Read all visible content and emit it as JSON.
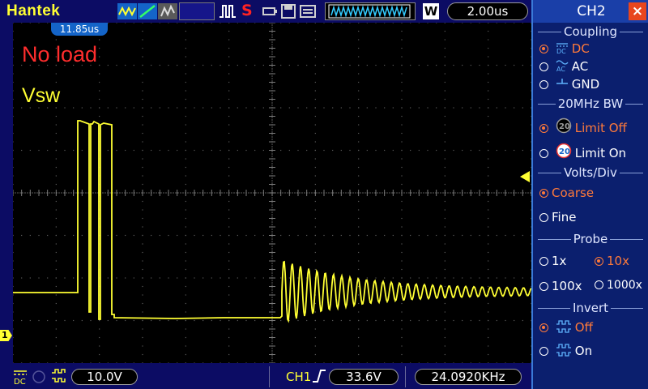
{
  "topbar": {
    "brand": "Hantek",
    "run_stop": "S",
    "format_label": "W",
    "timebase": "2.00us"
  },
  "screen": {
    "trigger_position": "11.85us",
    "annotation_noload": "No load",
    "annotation_vsw": "Vsw",
    "channel_marker": "1"
  },
  "bottombar": {
    "ch_volts": "10.0V",
    "trigger_source": "CH1",
    "trigger_level": "33.6V",
    "frequency": "24.0920KHz"
  },
  "menu": {
    "title": "CH2",
    "coupling": {
      "title": "Coupling",
      "options": [
        "DC",
        "AC",
        "GND"
      ],
      "selected": "DC"
    },
    "bw": {
      "title": "20MHz BW",
      "options": [
        "Limit Off",
        "Limit On"
      ],
      "icon_text": "20",
      "selected": "Limit Off"
    },
    "volts_div": {
      "title": "Volts/Div",
      "options": [
        "Coarse",
        "Fine"
      ],
      "selected": "Coarse"
    },
    "probe": {
      "title": "Probe",
      "options": [
        "1x",
        "10x",
        "100x",
        "1000x"
      ],
      "selected": "10x"
    },
    "invert": {
      "title": "Invert",
      "options": [
        "Off",
        "On"
      ],
      "selected": "Off"
    }
  },
  "colors": {
    "trace": "#ffff33",
    "frame": "#0c0c64",
    "menu_bg": "#0b1f6e",
    "selected": "#ff7a3a"
  }
}
